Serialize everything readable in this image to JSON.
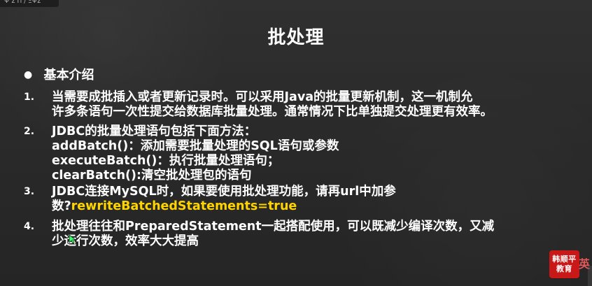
{
  "header": {
    "badge_text": "Ψ Σ Π ∕ ΞΨΣ",
    "title": "批处理"
  },
  "content": {
    "intro_label": "基本介绍",
    "items": [
      {
        "number": "1.",
        "lines": [
          "当需要成批插入或者更新记录时。可以采用Java的批量更新机制，这一机制允",
          "许多条语句一次性提交给数据库批量处理。通常情况下比单独提交处理更有效率。"
        ]
      },
      {
        "number": "2.",
        "lines": [
          "JDBC的批量处理语句包括下面方法：",
          "addBatch()：添加需要批量处理的SQL语句或参数",
          "executeBatch()：执行批量处理语句；",
          "clearBatch():清空批处理包的语句"
        ]
      },
      {
        "number": "3.",
        "line1": "JDBC连接MySQL时，如果要使用批处理功能，请再url中加参",
        "line2_prefix": "数?",
        "line2_highlight": "rewriteBatchedStatements=true"
      },
      {
        "number": "4.",
        "lines": [
          "批处理往往和PreparedStatement一起搭配使用，可以既减少编译次数，又减",
          "少运行次数，效率大大提高"
        ]
      }
    ]
  },
  "logo": {
    "line1": "韩顺平",
    "line2": "教育",
    "side_text": "英"
  },
  "colors": {
    "background": "#2b2b2b",
    "text": "#ffffff",
    "highlight": "#ffd400",
    "logo": "#c91818"
  }
}
